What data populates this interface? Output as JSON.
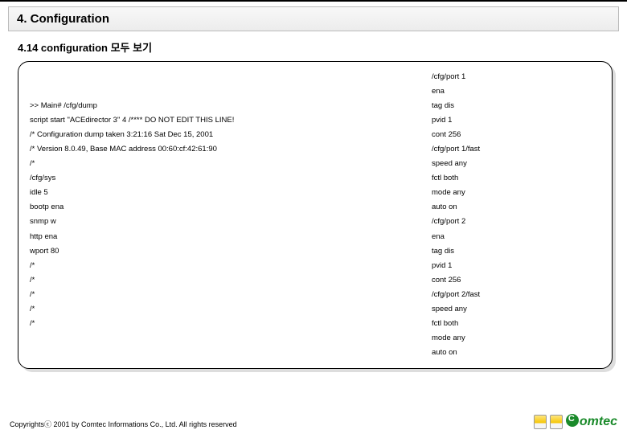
{
  "title": "4. Configuration",
  "subtitle": "4.14 configuration 모두 보기",
  "left": [
    "",
    "",
    ">> Main# /cfg/dump",
    "script start \"ACEdirector 3\" 4  /**** DO NOT EDIT THIS LINE!",
    "/* Configuration dump taken  3:21:16 Sat Dec 15, 2001",
    "/* Version 8.0.49,  Base MAC address 00:60:cf:42:61:90",
    "/*",
    "/cfg/sys",
    "idle 5",
    "bootp ena",
    "snmp w",
    "http ena",
    "wport 80",
    "/*",
    "/*",
    "/*",
    "/*",
    "/*"
  ],
  "right": [
    "/cfg/port 1",
    "ena",
    "tag dis",
    "pvid 1",
    "cont 256",
    "/cfg/port 1/fast",
    "speed any",
    "fctl both",
    "mode any",
    "auto on",
    "/cfg/port 2",
    "ena",
    "tag dis",
    "pvid 1",
    "cont 256",
    "/cfg/port 2/fast",
    "speed any",
    "fctl both",
    "mode any",
    "auto on"
  ],
  "copyright": "Copyrightsⓒ 2001 by Comtec Informations Co., Ltd. All rights reserved",
  "logo_text": "omtec"
}
